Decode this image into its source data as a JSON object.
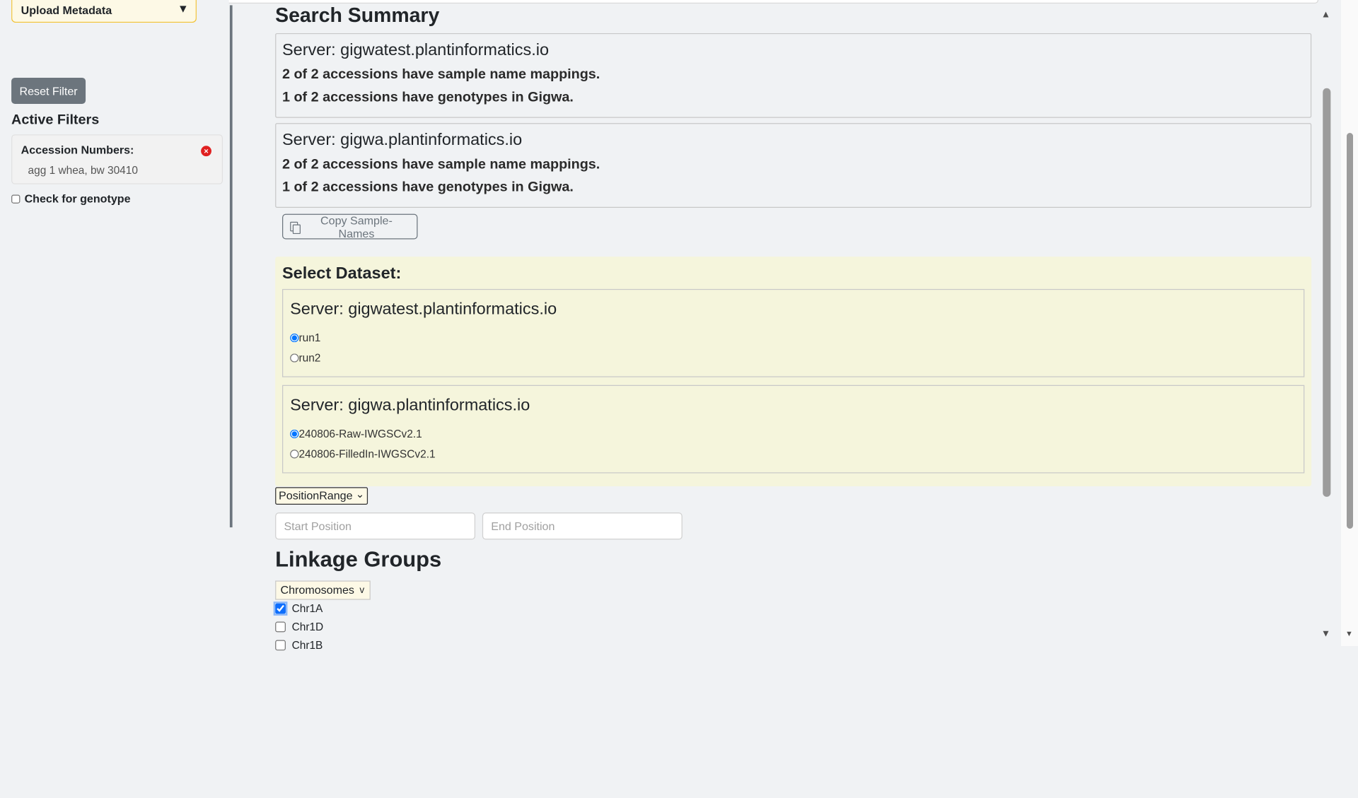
{
  "sidebar": {
    "upload_label": "Upload Metadata",
    "upload_caret": "▼",
    "reset_label": "Reset Filter",
    "active_filters_title": "Active Filters",
    "filter": {
      "label": "Accession Numbers:",
      "value": "agg 1 whea, bw 30410",
      "remove_icon": "×"
    },
    "genotype_check_label": "Check for genotype",
    "genotype_checked": false
  },
  "summary": {
    "title": "Search Summary",
    "servers": [
      {
        "title": "Server: gigwatest.plantinformatics.io",
        "mappings": "2 of 2 accessions have sample name mappings.",
        "genotypes": "1 of 2 accessions have genotypes in Gigwa."
      },
      {
        "title": "Server: gigwa.plantinformatics.io",
        "mappings": "2 of 2 accessions have sample name mappings.",
        "genotypes": "1 of 2 accessions have genotypes in Gigwa."
      }
    ],
    "copy_label": "Copy Sample-Names"
  },
  "dataset": {
    "title": "Select Dataset:",
    "servers": [
      {
        "title": "Server: gigwatest.plantinformatics.io",
        "options": [
          "run1",
          "run2"
        ],
        "selected": "run1"
      },
      {
        "title": "Server: gigwa.plantinformatics.io",
        "options": [
          "240806-Raw-IWGSCv2.1",
          "240806-FilledIn-IWGSCv2.1"
        ],
        "selected": "240806-Raw-IWGSCv2.1"
      }
    ]
  },
  "position": {
    "range_select": "PositionRange",
    "range_chevron": "⌄",
    "start_placeholder": "Start Position",
    "end_placeholder": "End Position"
  },
  "linkage": {
    "title": "Linkage Groups",
    "select_label": "Chromosomes",
    "select_chevron": "v",
    "items": [
      {
        "label": "Chr1A",
        "checked": true
      },
      {
        "label": "Chr1D",
        "checked": false
      },
      {
        "label": "Chr1B",
        "checked": false
      }
    ]
  },
  "scroll": {
    "up_arrow": "▲",
    "down_arrow": "▼"
  }
}
